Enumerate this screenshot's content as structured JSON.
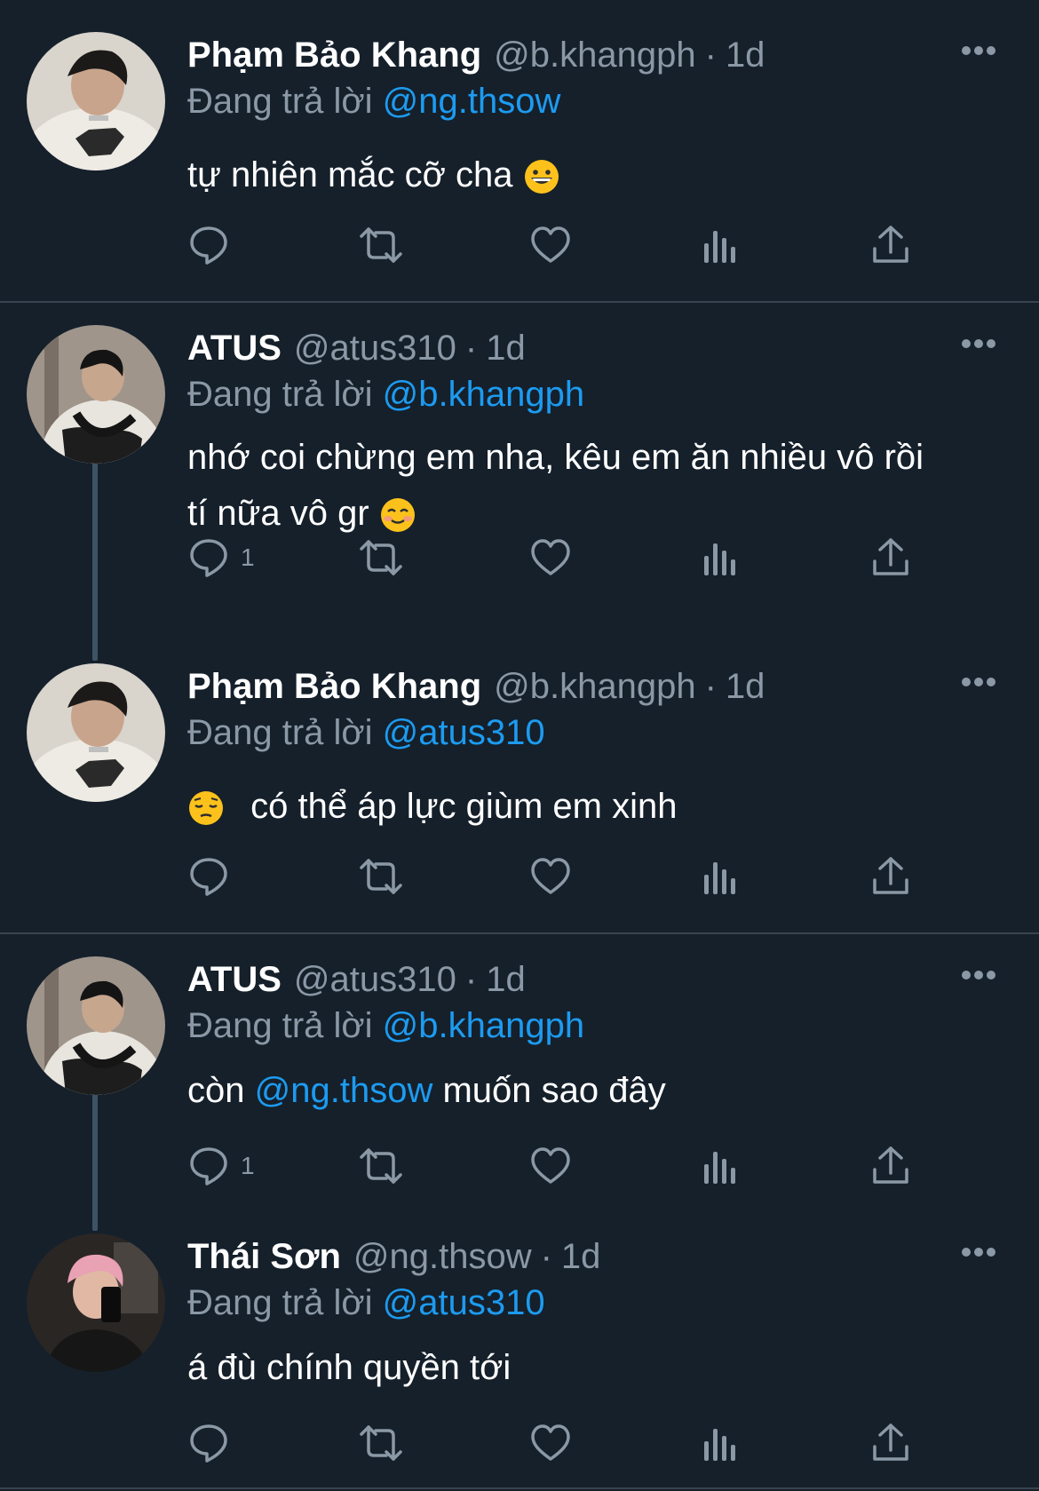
{
  "feed": {
    "replying_label": "Đang trả lời",
    "tweets": [
      {
        "name": "Phạm Bảo Khang",
        "handle": "@b.khangph",
        "separator": "·",
        "time": "1d",
        "reply_to": "@ng.thsow",
        "text": "tự nhiên mắc cỡ cha",
        "emoji": "grinning-face",
        "reply_count": ""
      },
      {
        "name": "ATUS",
        "handle": "@atus310",
        "separator": "·",
        "time": "1d",
        "reply_to": "@b.khangph",
        "text_line1": "nhớ coi chừng em nha, kêu em ăn nhiều vô rồi",
        "text_line2": "tí nữa vô gr",
        "emoji": "smiling-face",
        "reply_count": "1"
      },
      {
        "name": "Phạm Bảo Khang",
        "handle": "@b.khangph",
        "separator": "·",
        "time": "1d",
        "reply_to": "@atus310",
        "emoji": "pensive-face",
        "text": "có thể áp lực giùm em xinh",
        "reply_count": ""
      },
      {
        "name": "ATUS",
        "handle": "@atus310",
        "separator": "·",
        "time": "1d",
        "reply_to": "@b.khangph",
        "text_before": "còn",
        "text_mention": "@ng.thsow",
        "text_after": "muốn sao đây",
        "reply_count": "1"
      },
      {
        "name": "Thái Sơn",
        "handle": "@ng.thsow",
        "separator": "·",
        "time": "1d",
        "reply_to": "@atus310",
        "text": "á đù chính quyền tới",
        "reply_count": ""
      }
    ]
  },
  "icons": {
    "reply": "reply-icon",
    "retweet": "retweet-icon",
    "like": "like-icon",
    "views": "views-icon",
    "share": "share-icon",
    "more": "more-options-icon"
  },
  "colors": {
    "background": "#15202b",
    "primary_text": "#ffffff",
    "secondary_text": "#8b98a5",
    "accent": "#1d9bf0",
    "divider": "#38444d",
    "thread_line": "#3d5466"
  }
}
